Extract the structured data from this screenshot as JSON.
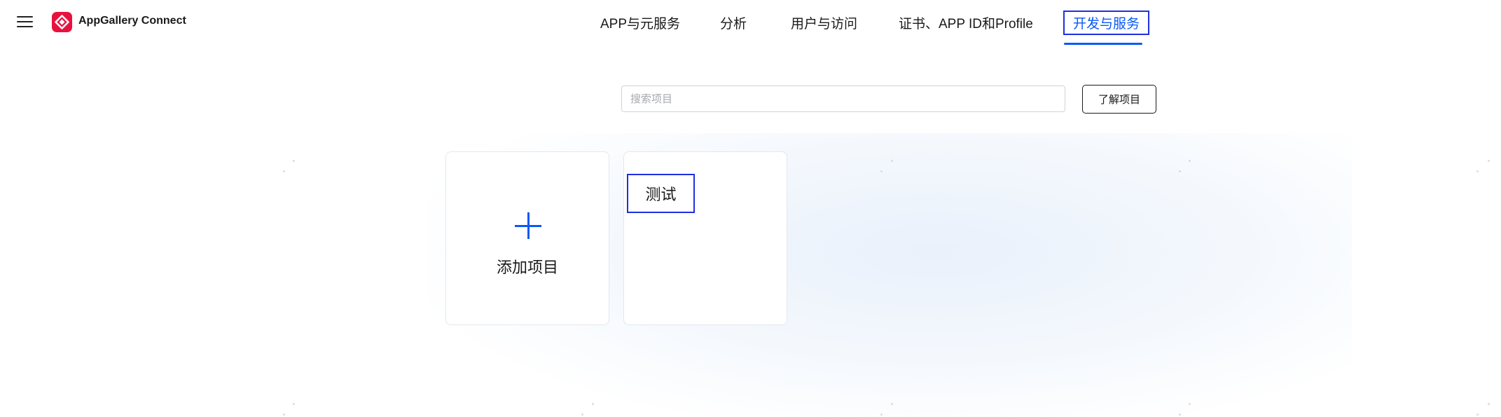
{
  "header": {
    "brand": "AppGallery Connect",
    "nav": [
      {
        "label": "APP与元服务"
      },
      {
        "label": "分析"
      },
      {
        "label": "用户与访问"
      },
      {
        "label": "证书、APP ID和Profile"
      },
      {
        "label": "开发与服务",
        "active": true
      }
    ],
    "accent_color": "#0a59f7"
  },
  "search": {
    "placeholder": "搜索项目",
    "value": ""
  },
  "learn_button": {
    "label": "了解项目"
  },
  "cards": {
    "add": {
      "label": "添加项目",
      "icon": "plus-icon"
    },
    "projects": [
      {
        "name": "测试"
      }
    ]
  },
  "icons": {
    "menu": "menu-icon",
    "logo": "appgallery-logo-icon"
  }
}
